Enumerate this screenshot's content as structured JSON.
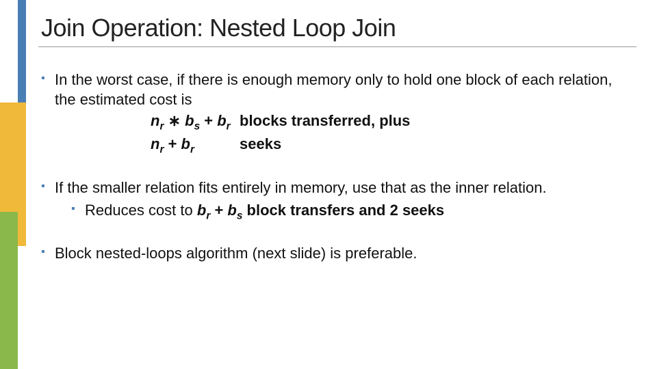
{
  "title": "Join Operation: Nested Loop Join",
  "bullets": {
    "b1": {
      "text": "In the worst case, if there is enough memory only to hold one block of each relation, the estimated cost is",
      "formula": {
        "line1_desc": "blocks transferred, plus",
        "line2_desc": "seeks"
      }
    },
    "b2": {
      "text": "If the smaller relation fits entirely in memory, use that as the inner relation.",
      "sub": {
        "prefix": "Reduces cost to ",
        "suffix": " block transfers and 2 seeks"
      }
    },
    "b3": {
      "text": "Block nested-loops algorithm (next slide) is preferable."
    }
  },
  "math": {
    "n": "n",
    "b": "b",
    "r": "r",
    "s": "s",
    "plus": " + ",
    "star": " ∗ "
  }
}
